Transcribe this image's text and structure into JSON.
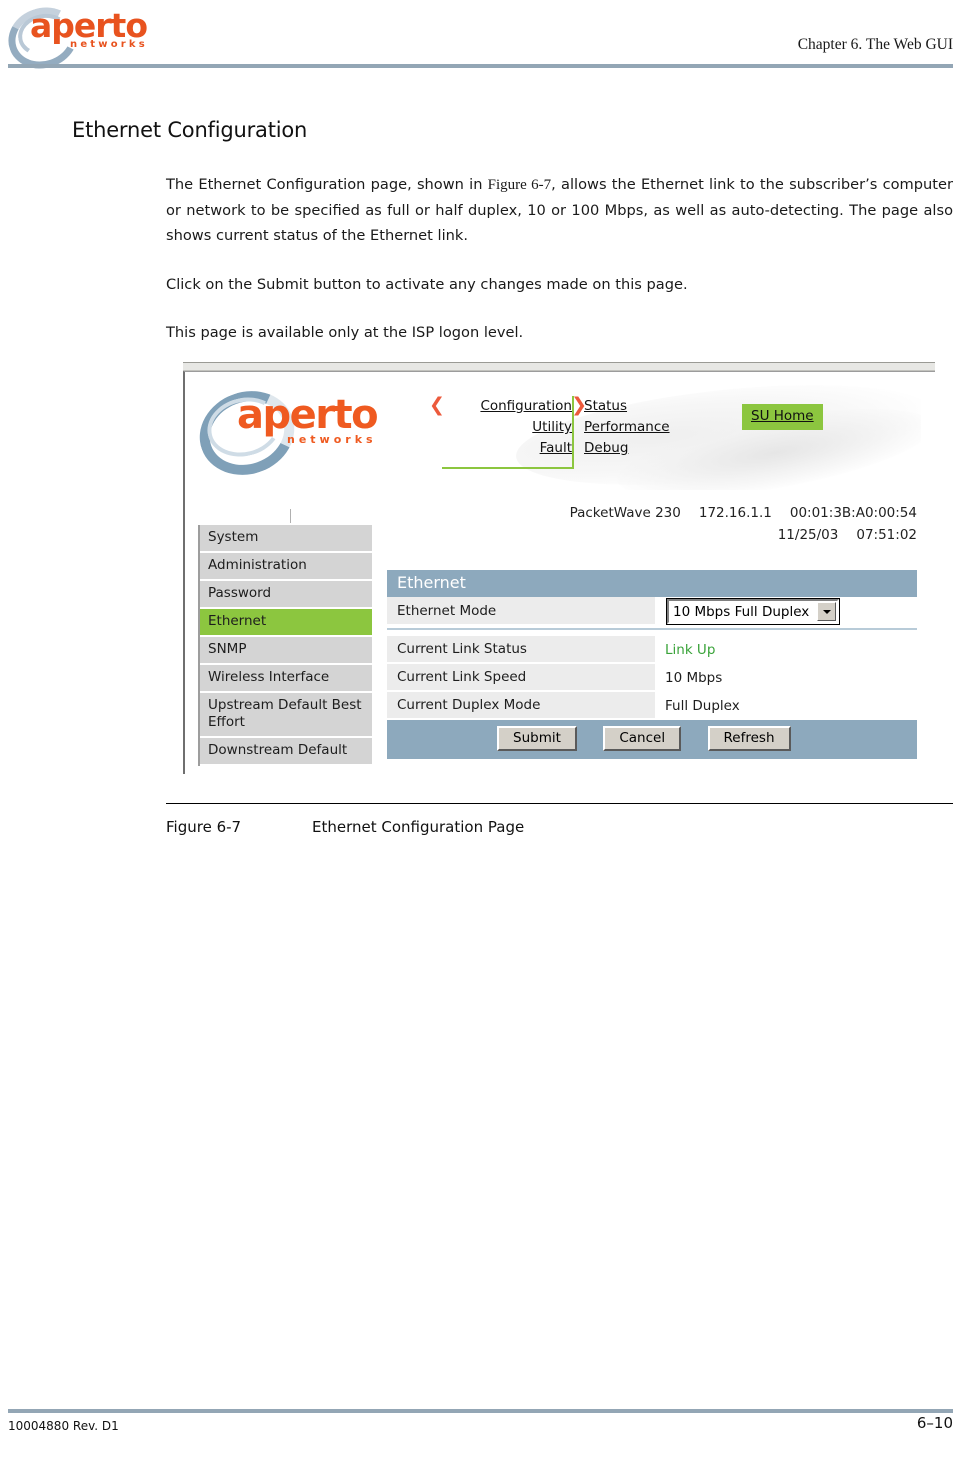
{
  "header": {
    "logo_word": "aperto",
    "logo_sub": "networks",
    "chapter": "Chapter 6.  The Web GUI"
  },
  "section": {
    "title": "Ethernet Configuration",
    "paragraph_1_before": "The Ethernet Configuration page, shown in ",
    "paragraph_1_figref": "Figure 6-7",
    "paragraph_1_after": ", allows the Ethernet link to the subscriber’s computer or network to be specified as full or half duplex, 10 or 100 Mbps, as well as auto-detecting. The page also shows current status of the Ethernet link.",
    "paragraph_2": "Click on the Submit button to activate any changes made on this page.",
    "paragraph_3": "This page is available only at the ISP logon level."
  },
  "screenshot": {
    "logo_word": "aperto",
    "logo_sub": "networks",
    "nav_left": [
      "Configuration",
      "Utility",
      "Fault"
    ],
    "nav_right": [
      "Status",
      "Performance",
      "Debug"
    ],
    "su_home": "SU Home",
    "arrow_left": "❮",
    "arrow_right": "❯",
    "device": {
      "model": "PacketWave 230",
      "ip": "172.16.1.1",
      "mac": "00:01:3B:A0:00:54",
      "date": "11/25/03",
      "time": "07:51:02"
    },
    "sidebar": [
      {
        "label": "System",
        "active": false
      },
      {
        "label": "Administration",
        "active": false
      },
      {
        "label": "Password",
        "active": false
      },
      {
        "label": "Ethernet",
        "active": true
      },
      {
        "label": "SNMP",
        "active": false
      },
      {
        "label": "Wireless Interface",
        "active": false
      },
      {
        "label": "Upstream Default Best Effort",
        "active": false
      },
      {
        "label": "Downstream Default",
        "active": false
      }
    ],
    "panel": {
      "title": "Ethernet",
      "mode_label": "Ethernet Mode",
      "mode_value": "10 Mbps Full Duplex",
      "rows": [
        {
          "label": "Current Link Status",
          "value": "Link Up",
          "green": true
        },
        {
          "label": "Current Link Speed",
          "value": "10 Mbps",
          "green": false
        },
        {
          "label": "Current Duplex Mode",
          "value": "Full Duplex",
          "green": false
        }
      ],
      "buttons": [
        "Submit",
        "Cancel",
        "Refresh"
      ]
    },
    "colors": {
      "accent_green": "#8cc63f",
      "panel_header": "#8da9bd",
      "logo_orange": "#ef5a20",
      "status_green": "#3aa33a"
    }
  },
  "figure": {
    "number": "Figure 6-7",
    "caption": "Ethernet Configuration Page"
  },
  "footer": {
    "doc_id": "10004880 Rev. D1",
    "page": "6–10"
  }
}
